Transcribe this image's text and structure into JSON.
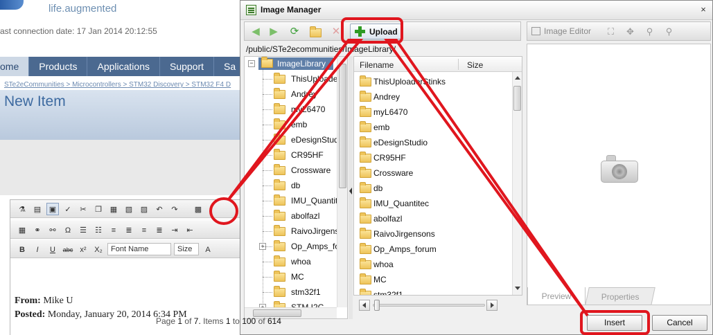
{
  "background": {
    "logo_text": "life.augmented",
    "last_connection": "ast connection date: 17 Jan 2014 20:12:55",
    "nav": [
      "ome",
      "Products",
      "Applications",
      "Support",
      "Sa"
    ],
    "breadcrumb": [
      "STe2eCommunities",
      "Microcontrollers",
      "STM32 Discovery",
      "STM32 F4 D"
    ],
    "breadcrumb_sep": ">",
    "page_title": "New Item",
    "editor": {
      "font_name": "Font Name",
      "size": "Size",
      "bold": "B",
      "italic": "I",
      "underline": "U",
      "strike": "abc",
      "superscript": "x²",
      "subscript": "X₂"
    },
    "mail": {
      "from_label": "From:",
      "from_value": "Mike U",
      "posted_label": "Posted:",
      "posted_value": "Monday, January 20, 2014 6:34 PM"
    }
  },
  "dialog": {
    "title": "Image Manager",
    "close": "×",
    "toolbar": {
      "upload": "Upload"
    },
    "path": "/public/STe2ecommunities/ImageLibrary/",
    "tree": {
      "root": "ImageLibrary",
      "root_toggle": "−",
      "folders": [
        "ThisUploade",
        "Andrey",
        "myL6470",
        "emb",
        "eDesignStud",
        "CR95HF",
        "Crossware",
        "db",
        "IMU_Quantit",
        "abolfazl",
        "RaivoJirgenso",
        "Op_Amps_fo",
        "whoa",
        "MC",
        "stm32f1",
        "STM I2C"
      ],
      "expand_glyph": "+"
    },
    "files": {
      "col_filename": "Filename",
      "col_size": "Size",
      "items": [
        "ThisUploaderStinks",
        "Andrey",
        "myL6470",
        "emb",
        "eDesignStudio",
        "CR95HF",
        "Crossware",
        "db",
        "IMU_Quantitec",
        "abolfazl",
        "RaivoJirgensons",
        "Op_Amps_forum",
        "whoa",
        "MC",
        "stm32f1"
      ]
    },
    "pager": {
      "page_word": "Page",
      "page": "1",
      "of_word": "of",
      "pages": "7.",
      "items_word": "Items",
      "from": "1",
      "to_word": "to",
      "to": "100",
      "total": "614"
    },
    "right": {
      "image_editor": "Image Editor",
      "tab_preview": "Preview",
      "tab_properties": "Properties"
    },
    "buttons": {
      "insert": "Insert",
      "cancel": "Cancel"
    }
  },
  "colors": {
    "annotation": "#e0161e",
    "nav": "#4b6990",
    "tree_selection": "#5f7fa8"
  }
}
